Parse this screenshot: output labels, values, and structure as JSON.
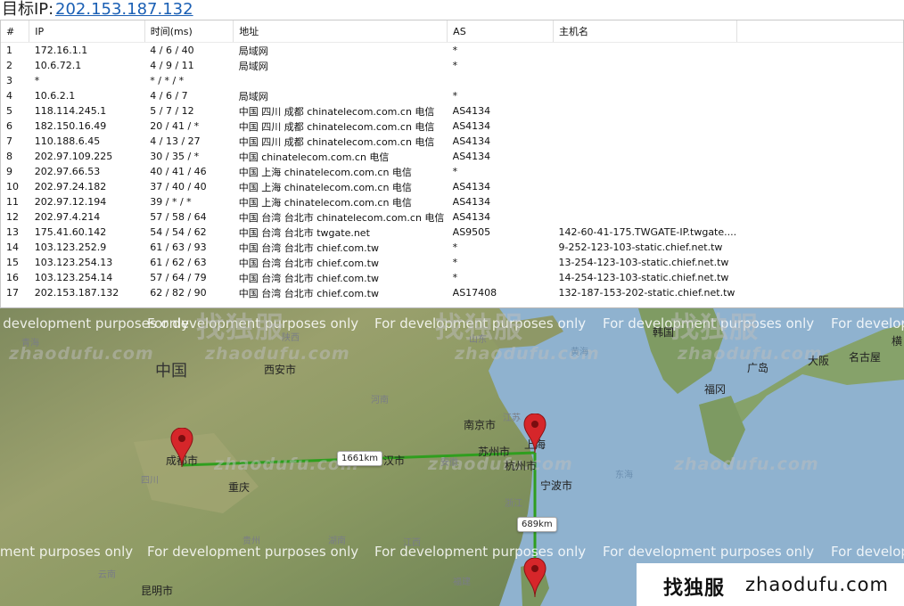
{
  "header": {
    "label": "目标IP:",
    "target_ip": "202.153.187.132"
  },
  "table": {
    "columns": [
      "#",
      "IP",
      "时间(ms)",
      "地址",
      "AS",
      "主机名"
    ],
    "rows": [
      [
        "1",
        "172.16.1.1",
        "4 / 6 / 40",
        "局域网",
        "*",
        ""
      ],
      [
        "2",
        "10.6.72.1",
        "4 / 9 / 11",
        "局域网",
        "*",
        ""
      ],
      [
        "3",
        "*",
        "* / * / *",
        "",
        "",
        ""
      ],
      [
        "4",
        "10.6.2.1",
        "4 / 6 / 7",
        "局域网",
        "*",
        ""
      ],
      [
        "5",
        "118.114.245.1",
        "5 / 7 / 12",
        "中国 四川 成都 chinatelecom.com.cn 电信",
        "AS4134",
        ""
      ],
      [
        "6",
        "182.150.16.49",
        "20 / 41 / *",
        "中国 四川 成都 chinatelecom.com.cn 电信",
        "AS4134",
        ""
      ],
      [
        "7",
        "110.188.6.45",
        "4 / 13 / 27",
        "中国 四川 成都 chinatelecom.com.cn 电信",
        "AS4134",
        ""
      ],
      [
        "8",
        "202.97.109.225",
        "30 / 35 / *",
        "中国 chinatelecom.com.cn 电信",
        "AS4134",
        ""
      ],
      [
        "9",
        "202.97.66.53",
        "40 / 41 / 46",
        "中国 上海 chinatelecom.com.cn 电信",
        "*",
        ""
      ],
      [
        "10",
        "202.97.24.182",
        "37 / 40 / 40",
        "中国 上海 chinatelecom.com.cn 电信",
        "AS4134",
        ""
      ],
      [
        "11",
        "202.97.12.194",
        "39 / * / *",
        "中国 上海 chinatelecom.com.cn 电信",
        "AS4134",
        ""
      ],
      [
        "12",
        "202.97.4.214",
        "57 / 58 / 64",
        "中国 台湾 台北市 chinatelecom.com.cn 电信",
        "AS4134",
        ""
      ],
      [
        "13",
        "175.41.60.142",
        "54 / 54 / 62",
        "中国 台湾 台北市 twgate.net",
        "AS9505",
        "142-60-41-175.TWGATE-IP.twgate...."
      ],
      [
        "14",
        "103.123.252.9",
        "61 / 63 / 93",
        "中国 台湾 台北市 chief.com.tw",
        "*",
        "9-252-123-103-static.chief.net.tw"
      ],
      [
        "15",
        "103.123.254.13",
        "61 / 62 / 63",
        "中国 台湾 台北市 chief.com.tw",
        "*",
        "13-254-123-103-static.chief.net.tw"
      ],
      [
        "16",
        "103.123.254.14",
        "57 / 64 / 79",
        "中国 台湾 台北市 chief.com.tw",
        "*",
        "14-254-123-103-static.chief.net.tw"
      ],
      [
        "17",
        "202.153.187.132",
        "62 / 82 / 90",
        "中国 台湾 台北市 chief.com.tw",
        "AS17408",
        "132-187-153-202-static.chief.net.tw"
      ]
    ]
  },
  "map": {
    "country_label": "中国",
    "cities": [
      "西安市",
      "南京市",
      "苏州市",
      "上海",
      "杭州市",
      "宁波市",
      "成都市",
      "重庆",
      "昆明市",
      "韩国",
      "广岛",
      "大阪",
      "名古屋",
      "福冈",
      "汉市",
      "横"
    ],
    "provinces": [
      "青海",
      "山东",
      "河南",
      "江苏",
      "安徽",
      "浙江",
      "四川",
      "贵州",
      "湖南",
      "江西",
      "福建",
      "陕西",
      "湖北",
      "东海",
      "黄海",
      "云南"
    ],
    "distances": [
      "1661km",
      "689km"
    ],
    "dev_watermark": "For development purposes only",
    "site_watermark": "zhaodufu.com",
    "logo_watermark": "找独服",
    "route_color": "#2f9e1e",
    "pin_color": "#d6262a"
  },
  "footer_logo": {
    "cn": "找独服",
    "en": "zhaodufu.com"
  }
}
